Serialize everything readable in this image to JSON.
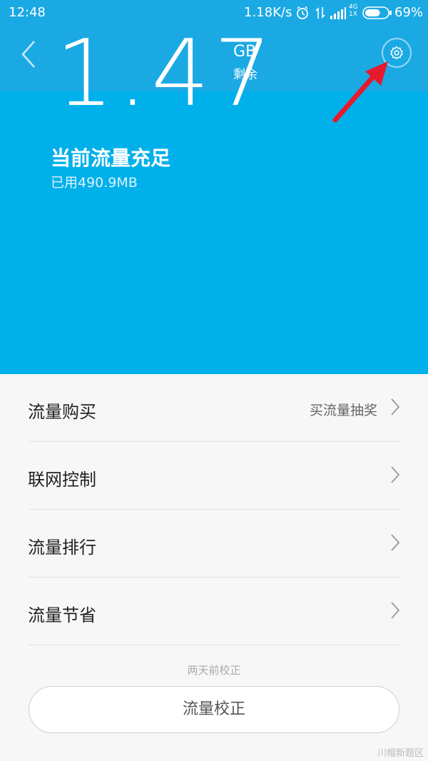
{
  "status_bar": {
    "time": "12:48",
    "net_speed": "1.18K/s",
    "battery_percent": "69%",
    "battery_level": 0.69,
    "icons": [
      "alarm-icon",
      "data-arrows-icon",
      "signal-icon",
      "4g-icon",
      "battery-icon"
    ],
    "network_type": "4G",
    "network_sub": "1X"
  },
  "header": {
    "remaining_value": "1.47",
    "remaining_unit": "GB",
    "remaining_label": "剩余",
    "status_title": "当前流量充足",
    "used_text": "已用490.9MB"
  },
  "menu": {
    "items": [
      {
        "label": "流量购买",
        "hint": "买流量抽奖"
      },
      {
        "label": "联网控制",
        "hint": ""
      },
      {
        "label": "流量排行",
        "hint": ""
      },
      {
        "label": "流量节省",
        "hint": ""
      }
    ]
  },
  "calibration": {
    "note": "两天前校正",
    "button_label": "流量校正"
  },
  "watermark": "川帽新题区",
  "colors": {
    "hero_bg": "#00b0ea",
    "hero_top": "#1ba9e4",
    "arrow": "#e8192c",
    "page_bg": "#f7f7f7"
  }
}
